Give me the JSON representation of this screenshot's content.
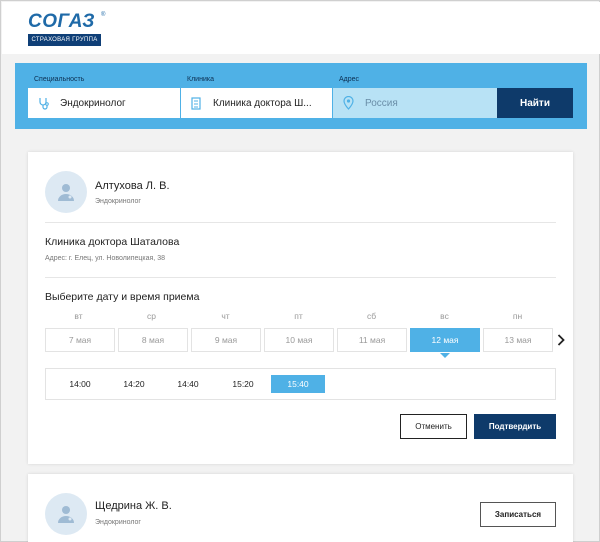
{
  "brand": {
    "logo_text": "СОГАЗ",
    "logo_reg": "®",
    "logo_sub": "СТРАХОВАЯ ГРУППА",
    "primary_color": "#0e3a6a",
    "accent_color": "#4fb1e6"
  },
  "search": {
    "specialty": {
      "label": "Специальность",
      "value": "Эндокринолог",
      "icon": "stethoscope-icon"
    },
    "clinic": {
      "label": "Клиника",
      "value": "Клиника доктора Ш...",
      "icon": "building-icon"
    },
    "address": {
      "label": "Адрес",
      "value": "Россия",
      "icon": "map-pin-icon"
    },
    "find_label": "Найти"
  },
  "doctors": [
    {
      "name": "Алтухова Л. В.",
      "specialty": "Эндокринолог",
      "clinic": "Клиника доктора Шаталова",
      "address": "Адрес: г. Елец, ул. Новолипецкая, 38",
      "choose_title": "Выберите дату и время приема",
      "days": [
        {
          "weekday": "вт",
          "date": "7 мая",
          "active": false
        },
        {
          "weekday": "ср",
          "date": "8 мая",
          "active": false
        },
        {
          "weekday": "чт",
          "date": "9 мая",
          "active": false
        },
        {
          "weekday": "пт",
          "date": "10 мая",
          "active": false
        },
        {
          "weekday": "сб",
          "date": "11 мая",
          "active": false
        },
        {
          "weekday": "вс",
          "date": "12 мая",
          "active": true
        },
        {
          "weekday": "пн",
          "date": "13 мая",
          "active": false
        }
      ],
      "slots": [
        {
          "time": "14:00",
          "active": false
        },
        {
          "time": "14:20",
          "active": false
        },
        {
          "time": "14:40",
          "active": false
        },
        {
          "time": "15:20",
          "active": false
        },
        {
          "time": "15:40",
          "active": true
        }
      ],
      "cancel_label": "Отменить",
      "confirm_label": "Подтвердить"
    },
    {
      "name": "Щедрина Ж. В.",
      "specialty": "Эндокринолог",
      "book_label": "Записаться"
    }
  ]
}
